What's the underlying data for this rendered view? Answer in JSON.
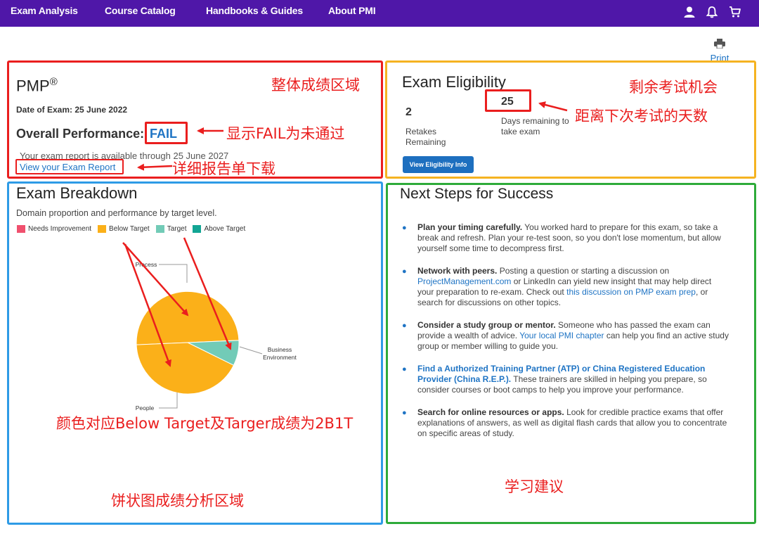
{
  "nav": {
    "links": [
      "Exam Analysis",
      "Course Catalog",
      "Handbooks & Guides",
      "About PMI"
    ],
    "icons": [
      "user-icon",
      "bell-icon",
      "cart-icon"
    ]
  },
  "print": {
    "label": "Print",
    "icon": "printer-icon"
  },
  "performance": {
    "title": "PMP",
    "registered": "®",
    "date_label": "Date of Exam: 25 June 2022",
    "overall_label": "Overall Performance:",
    "overall_value": "FAIL",
    "availability": "Your exam report is available through 25 June 2027",
    "report_link": "View your Exam Report"
  },
  "eligibility": {
    "title": "Exam Eligibility",
    "retakes_value": "2",
    "retakes_label": "Retakes Remaining",
    "days_value": "25",
    "days_label": "Days remaining to take exam",
    "button": "View Eligibility Info"
  },
  "breakdown": {
    "title": "Exam Breakdown",
    "subtitle": "Domain proportion and performance by target level.",
    "legend": [
      {
        "label": "Needs Improvement",
        "color": "#f0506e"
      },
      {
        "label": "Below Target",
        "color": "#fbb019"
      },
      {
        "label": "Target",
        "color": "#72cbb7"
      },
      {
        "label": "Above Target",
        "color": "#12a594"
      }
    ]
  },
  "chart_data": {
    "type": "pie",
    "slices": [
      {
        "label": "Process",
        "value": 50,
        "level": "Below Target",
        "color": "#fbb019"
      },
      {
        "label": "Business Environment",
        "value": 8,
        "level": "Target",
        "color": "#72cbb7"
      },
      {
        "label": "People",
        "value": 42,
        "level": "Below Target",
        "color": "#fbb019"
      }
    ]
  },
  "next_steps": {
    "title": "Next Steps for Success",
    "items": [
      {
        "head": "Plan your timing carefully.",
        "text": " You worked hard to prepare for this exam, so take a break and refresh. Plan your re-test soon, so you don't lose momentum, but allow yourself some time to decompress first."
      },
      {
        "head": "Network with peers.",
        "t1": " Posting a question or starting a discussion on ",
        "l1": "ProjectManagement.com",
        "t2": " or LinkedIn can yield new insight that may help direct your preparation to re-exam. Check out ",
        "l2": "this discussion on PMP exam prep",
        "t3": ", or search for discussions on other topics."
      },
      {
        "head": "Consider a study group or mentor.",
        "t1": " Someone who has passed the exam can provide a wealth of advice. ",
        "l1": "Your local PMI chapter",
        "t2": " can help you find an active study group or member willing to guide you."
      },
      {
        "head": "Find a Authorized Training Partner (ATP) or China Registered Education Provider (China R.E.P.).",
        "text": " These trainers are skilled in helping you prepare, so consider courses or boot camps to help you improve your performance."
      },
      {
        "head": "Search for online resources or apps.",
        "text": " Look for credible practice exams that offer explanations of answers, as well as digital flash cards that allow you to concentrate on specific areas of study."
      }
    ]
  },
  "annotations": {
    "perf_area": "整体成绩区域",
    "fail_note": "显示FAIL为未通过",
    "report_note": "详细报告单下载",
    "retakes_note": "剩余考试机会",
    "days_note": "距离下次考试的天数",
    "color_note": "颜色对应Below Target及Targer成绩为2B1T",
    "pie_area": "饼状图成绩分析区域",
    "advice": "学习建议",
    "red": "#ea1e1e",
    "yellow": "#f5b321",
    "blue": "#2e9be6",
    "green": "#2eab3a"
  }
}
